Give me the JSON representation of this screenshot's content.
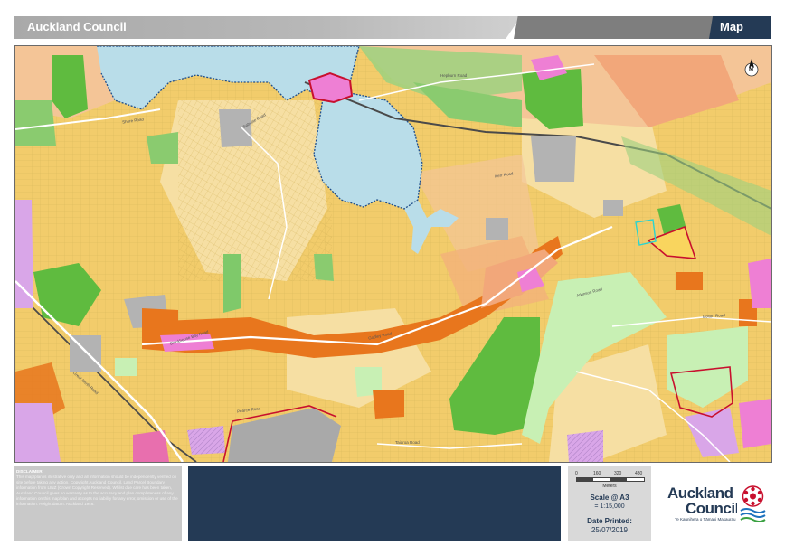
{
  "header": {
    "title": "Auckland Council",
    "map_label": "Map"
  },
  "map": {
    "north_arrow_label": "N",
    "street_labels": [
      {
        "name": "Shore Road",
        "rotate": -8,
        "pos": "upper-left"
      },
      {
        "name": "Great North Road",
        "rotate": 42,
        "pos": "lower-left"
      },
      {
        "name": "Blockhouse Bay Road",
        "rotate": -18,
        "pos": "center-left"
      },
      {
        "name": "Pearce Road",
        "rotate": -8,
        "pos": "bottom-left"
      },
      {
        "name": "Godley Road",
        "rotate": -12,
        "pos": "center"
      },
      {
        "name": "Sabulite Road",
        "rotate": -30,
        "pos": "upper-center"
      },
      {
        "name": "Atkinson Road",
        "rotate": -15,
        "pos": "center-right"
      },
      {
        "name": "Taiaroa Road",
        "rotate": 0,
        "pos": "bottom-center"
      },
      {
        "name": "Bolton Road",
        "rotate": -4,
        "pos": "right"
      },
      {
        "name": "Hepburn Road",
        "rotate": 0,
        "pos": "top-center"
      },
      {
        "name": "Kerr Road",
        "rotate": -10,
        "pos": "upper-right"
      }
    ],
    "colors": {
      "residential": "#f2cc6b",
      "light_residential": "#f7e3ad",
      "mixed": "#f2b27a",
      "town_centre": "#e8761d",
      "open_space": "#5fbb3f",
      "light_green": "#c8f0b4",
      "water": "#b9dde9",
      "grey": "#b3b3b3",
      "pink": "#ee7fd4",
      "lilac": "#d9a6e8",
      "boundary_red": "#c8102e"
    }
  },
  "disclaimer": {
    "heading": "DISCLAIMER:",
    "body": "This map/plan is illustrative only and all information should be independently verified on site before taking any action. Copyright Auckland Council. Land Parcel Boundary information from LINZ (Crown Copyright Reserved). Whilst due care has been taken, Auckland Council gives no warranty as to the accuracy and plan completeness of any information on this map/plan and accepts no liability for any error, omission or use of the information. Height datum: Auckland 1946."
  },
  "scale": {
    "ticks": [
      "0",
      "160",
      "320",
      "480"
    ],
    "units": "Meters",
    "label": "Scale @ A3",
    "ratio": "= 1:15,000",
    "date_label": "Date Printed:",
    "date_value": "25/07/2019"
  },
  "logo": {
    "line1": "Auckland",
    "line2": "Council",
    "subtitle": "Te Kaunihera o Tāmaki Makaurau"
  }
}
